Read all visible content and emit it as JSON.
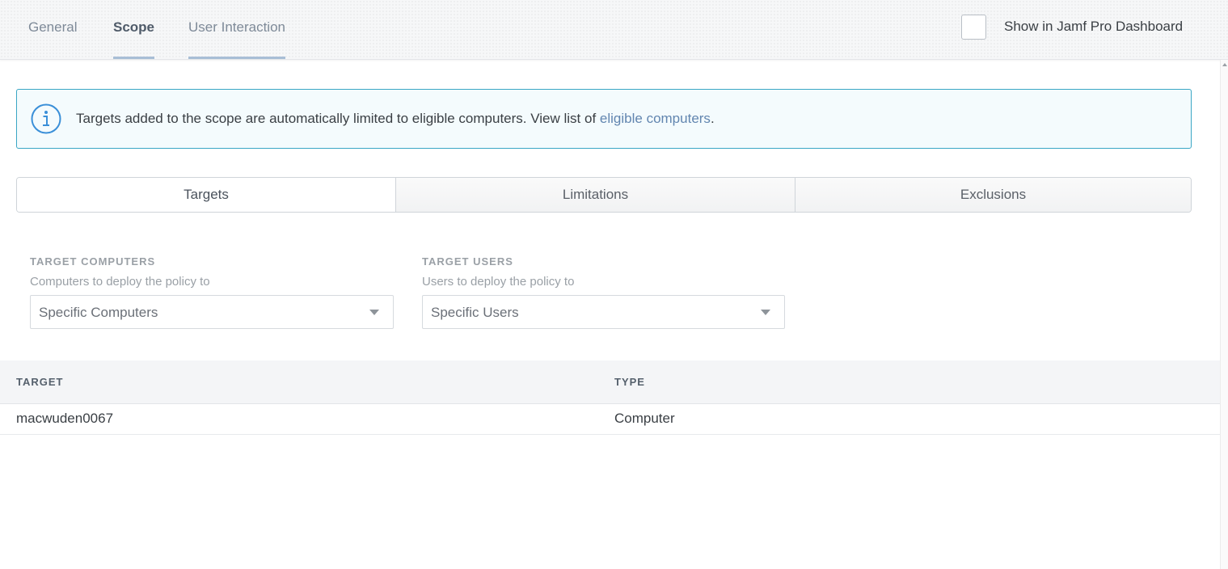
{
  "tabs": [
    {
      "label": "General",
      "active": false
    },
    {
      "label": "Scope",
      "active": true
    },
    {
      "label": "User Interaction",
      "active": false
    }
  ],
  "dashboard": {
    "label": "Show in Jamf Pro Dashboard",
    "checked": false
  },
  "info_banner": {
    "icon": "info-icon",
    "text": "Targets added to the scope are automatically limited to eligible computers. View list of ",
    "link": "eligible computers",
    "suffix": "."
  },
  "scope_tabs": [
    {
      "label": "Targets",
      "active": true
    },
    {
      "label": "Limitations",
      "active": false
    },
    {
      "label": "Exclusions",
      "active": false
    }
  ],
  "target_computers": {
    "title": "TARGET COMPUTERS",
    "help": "Computers to deploy the policy to",
    "value": "Specific Computers"
  },
  "target_users": {
    "title": "TARGET USERS",
    "help": "Users to deploy the policy to",
    "value": "Specific Users"
  },
  "table": {
    "columns": [
      "TARGET",
      "TYPE"
    ],
    "rows": [
      [
        "macwuden0067",
        "Computer"
      ]
    ]
  },
  "colors": {
    "accent": "#a8bed6",
    "info_border": "#3aa6c5",
    "info_icon": "#3a8fd8",
    "link": "#6286b0"
  }
}
